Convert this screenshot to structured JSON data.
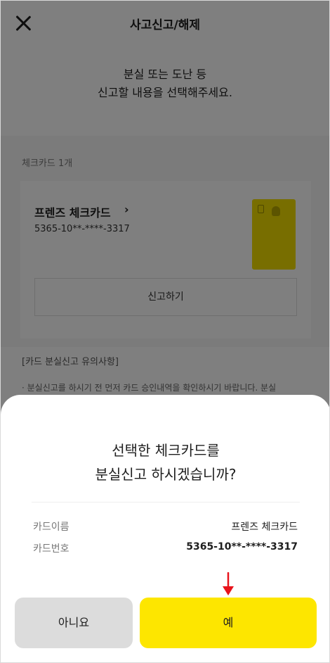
{
  "header": {
    "title": "사고신고/해제",
    "close_icon": "close-icon"
  },
  "intro": {
    "line1": "분실 또는 도난 등",
    "line2": "신고할 내용을 선택해주세요."
  },
  "card_section": {
    "count_label": "체크카드 1개",
    "card_name": "프렌즈 체크카드",
    "chevron": "›",
    "card_number": "5365-10**-****-3317",
    "card_color": "#f0dc00",
    "report_button": "신고하기"
  },
  "notice": {
    "title": "[카드 분실신고 유의사항]",
    "text": "· 분실신고를 하시기 전 먼저 카드 승인내역을 확인하시기 바랍니다. 분실"
  },
  "sheet": {
    "title_line1": "선택한 체크카드를",
    "title_line2": "분실신고 하시겠습니까?",
    "info": [
      {
        "label": "카드이름",
        "value": "프렌즈 체크카드"
      },
      {
        "label": "카드번호",
        "value": "5365-10**-****-3317"
      }
    ],
    "no_button": "아니요",
    "yes_button": "예",
    "yes_color": "#fde600",
    "arrow_color": "#e8131b"
  }
}
